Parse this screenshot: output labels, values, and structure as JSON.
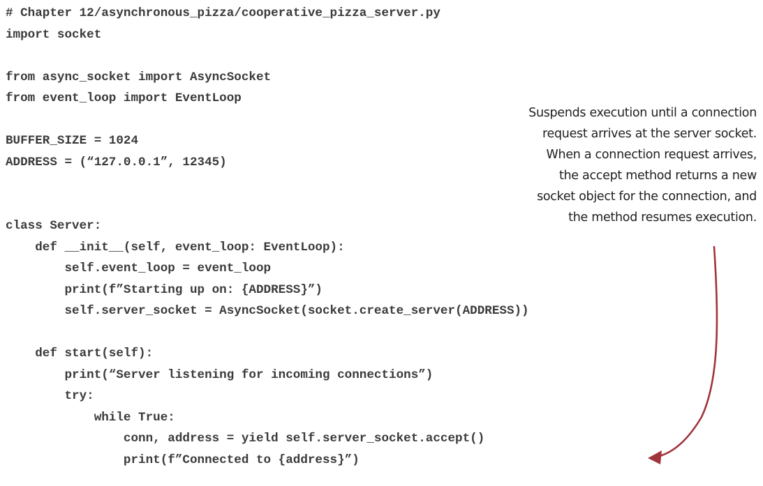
{
  "code": {
    "lines": [
      "# Chapter 12/asynchronous_pizza/cooperative_pizza_server.py",
      "import socket",
      "",
      "from async_socket import AsyncSocket",
      "from event_loop import EventLoop",
      "",
      "BUFFER_SIZE = 1024",
      "ADDRESS = (“127.0.0.1”, 12345)",
      "",
      "",
      "class Server:",
      "    def __init__(self, event_loop: EventLoop):",
      "        self.event_loop = event_loop",
      "        print(f”Starting up on: {ADDRESS}”)",
      "        self.server_socket = AsyncSocket(socket.create_server(ADDRESS))",
      "",
      "    def start(self):",
      "        print(“Server listening for incoming connections”)",
      "        try:",
      "            while True:",
      "                conn, address = yield self.server_socket.accept()",
      "                print(f”Connected to {address}”)"
    ]
  },
  "annotation": {
    "lines": [
      "Suspends execution until a connection",
      "request arrives at the server socket.",
      "When a connection request arrives,",
      "the accept method returns a new",
      "socket object for the connection, and",
      "the method resumes execution."
    ]
  },
  "colors": {
    "code_text": "#3a3a3a",
    "annotation_text": "#1e1e1e",
    "arrow": "#a0343c"
  }
}
